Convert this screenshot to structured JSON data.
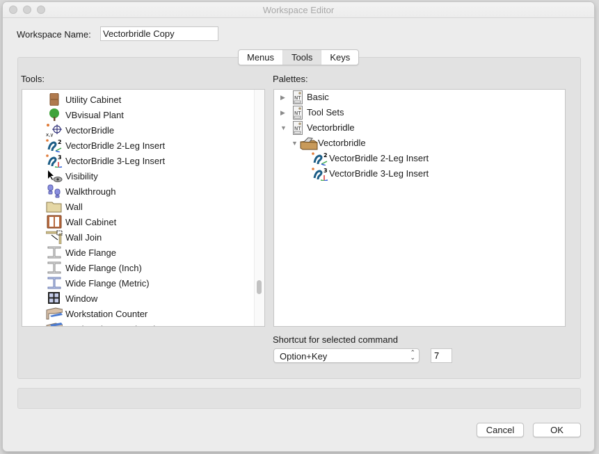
{
  "window": {
    "title": "Workspace Editor"
  },
  "workspace_name": {
    "label": "Workspace Name:",
    "value": "Vectorbridle Copy"
  },
  "tabs": [
    {
      "label": "Menus",
      "active": false
    },
    {
      "label": "Tools",
      "active": true
    },
    {
      "label": "Keys",
      "active": false
    }
  ],
  "tools": {
    "label": "Tools:",
    "items": [
      {
        "label": "Utility Cabinet",
        "icon": "cabinet-icon"
      },
      {
        "label": "VBvisual Plant",
        "icon": "plant-icon"
      },
      {
        "label": "VectorBridle",
        "icon": "vectorbridle-icon"
      },
      {
        "label": "VectorBridle 2-Leg Insert",
        "icon": "vectorbridle-2leg-icon"
      },
      {
        "label": "VectorBridle 3-Leg Insert",
        "icon": "vectorbridle-3leg-icon"
      },
      {
        "label": "Visibility",
        "icon": "visibility-icon"
      },
      {
        "label": "Walkthrough",
        "icon": "walkthrough-icon"
      },
      {
        "label": "Wall",
        "icon": "wall-icon"
      },
      {
        "label": "Wall Cabinet",
        "icon": "wall-cabinet-icon"
      },
      {
        "label": "Wall Join",
        "icon": "wall-join-icon"
      },
      {
        "label": "Wide Flange",
        "icon": "wide-flange-icon"
      },
      {
        "label": "Wide Flange (Inch)",
        "icon": "wide-flange-icon"
      },
      {
        "label": "Wide Flange (Metric)",
        "icon": "wide-flange-metric-icon"
      },
      {
        "label": "Window",
        "icon": "window-icon"
      },
      {
        "label": "Workstation Counter",
        "icon": "workstation-counter-icon"
      },
      {
        "label": "Workstation Overhead",
        "icon": "workstation-overhead-icon"
      }
    ]
  },
  "palettes": {
    "label": "Palettes:",
    "items": [
      {
        "label": "Basic",
        "level": 0,
        "expanded": false,
        "icon": "palette-icon"
      },
      {
        "label": "Tool Sets",
        "level": 0,
        "expanded": false,
        "icon": "palette-icon"
      },
      {
        "label": "Vectorbridle",
        "level": 0,
        "expanded": true,
        "icon": "palette-icon"
      },
      {
        "label": "Vectorbridle",
        "level": 1,
        "expanded": true,
        "icon": "toolbox-icon"
      },
      {
        "label": "VectorBridle 2-Leg Insert",
        "level": 2,
        "icon": "vectorbridle-2leg-icon"
      },
      {
        "label": "VectorBridle 3-Leg Insert",
        "level": 2,
        "icon": "vectorbridle-3leg-icon"
      }
    ]
  },
  "shortcut": {
    "label": "Shortcut for selected command",
    "modifier": "Option+Key",
    "key": "7"
  },
  "buttons": {
    "cancel": "Cancel",
    "ok": "OK"
  }
}
